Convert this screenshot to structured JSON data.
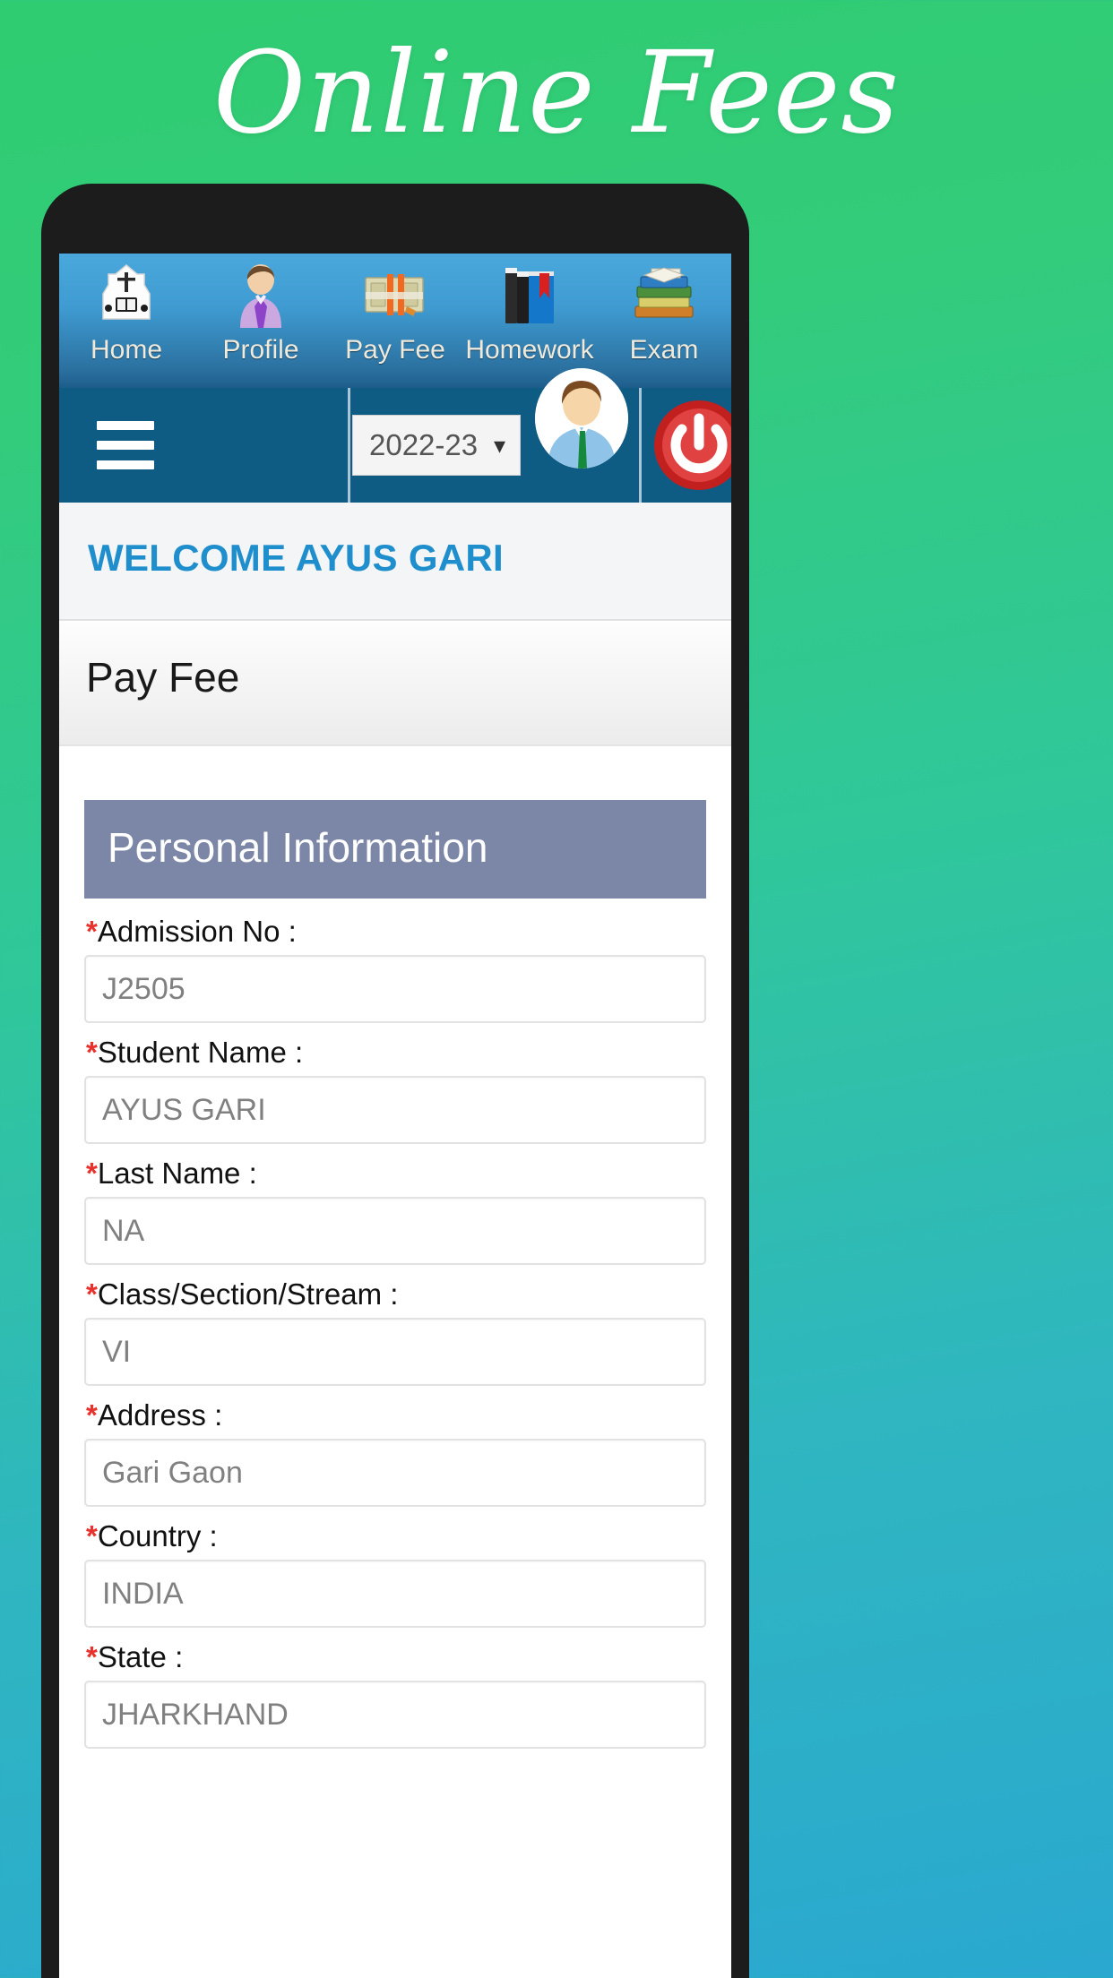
{
  "promo": {
    "title": "Online Fees",
    "background_colors": [
      "#2fcc71",
      "#2aa8d0"
    ]
  },
  "icon_nav": {
    "items": [
      {
        "label": "Home",
        "icon": "school-crest-icon"
      },
      {
        "label": "Profile",
        "icon": "person-profile-icon"
      },
      {
        "label": "Pay Fee",
        "icon": "money-bills-icon"
      },
      {
        "label": "Homework",
        "icon": "books-bookmark-icon"
      },
      {
        "label": "Exam",
        "icon": "exam-books-icon"
      }
    ],
    "accent": "#3f9bd1"
  },
  "header": {
    "menu_icon": "hamburger-menu-icon",
    "session_year": "2022-23",
    "dropdown_icon": "chevron-down-icon",
    "avatar_icon": "user-avatar-icon",
    "logout_icon": "power-logout-icon",
    "background": "#0e5c84"
  },
  "welcome": {
    "text": "WELCOME AYUS GARI",
    "color": "#1f8ecd"
  },
  "page": {
    "title": "Pay Fee"
  },
  "form": {
    "section_title": "Personal Information",
    "section_color": "#7c87a7",
    "required_marker": "*",
    "fields": [
      {
        "label": "Admission No :",
        "value": "J2505",
        "required": true
      },
      {
        "label": "Student Name :",
        "value": "AYUS GARI",
        "required": true
      },
      {
        "label": "Last Name :",
        "value": "NA",
        "required": true
      },
      {
        "label": "Class/Section/Stream :",
        "value": "VI",
        "required": true
      },
      {
        "label": "Address :",
        "value": "Gari Gaon",
        "required": true
      },
      {
        "label": "Country :",
        "value": "INDIA",
        "required": true
      },
      {
        "label": "State :",
        "value": "JHARKHAND",
        "required": true
      }
    ]
  }
}
